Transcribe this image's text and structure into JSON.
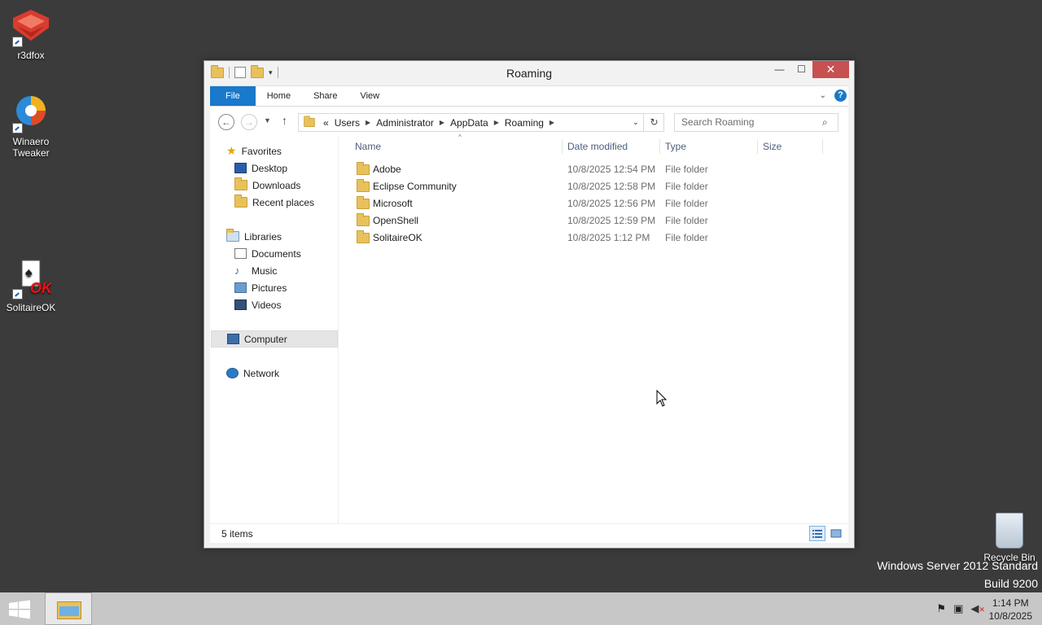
{
  "desktop": {
    "icons": [
      {
        "label": "r3dfox"
      },
      {
        "label": "Winaero\nTweaker"
      },
      {
        "label": "SolitaireOK"
      }
    ],
    "recycle_bin": "Recycle Bin",
    "watermark_line1": "Windows Server 2012 Standard",
    "watermark_line2": "Build 9200"
  },
  "window": {
    "title": "Roaming",
    "controls": {
      "minimize": "—",
      "maximize": "☐",
      "close": "✕"
    },
    "ribbon": {
      "tabs": [
        "File",
        "Home",
        "Share",
        "View"
      ],
      "help": "?"
    },
    "address": {
      "overflow": "«",
      "crumbs": [
        "Users",
        "Administrator",
        "AppData",
        "Roaming"
      ]
    },
    "search": {
      "placeholder": "Search Roaming"
    },
    "nav": {
      "favorites": "Favorites",
      "desktop": "Desktop",
      "downloads": "Downloads",
      "recent": "Recent places",
      "libraries": "Libraries",
      "documents": "Documents",
      "music": "Music",
      "pictures": "Pictures",
      "videos": "Videos",
      "computer": "Computer",
      "network": "Network"
    },
    "columns": {
      "name": "Name",
      "date": "Date modified",
      "type": "Type",
      "size": "Size"
    },
    "files": [
      {
        "name": "Adobe",
        "date": "10/8/2025 12:54 PM",
        "type": "File folder"
      },
      {
        "name": "Eclipse Community",
        "date": "10/8/2025 12:58 PM",
        "type": "File folder"
      },
      {
        "name": "Microsoft",
        "date": "10/8/2025 12:56 PM",
        "type": "File folder"
      },
      {
        "name": "OpenShell",
        "date": "10/8/2025 12:59 PM",
        "type": "File folder"
      },
      {
        "name": "SolitaireOK",
        "date": "10/8/2025 1:12 PM",
        "type": "File folder"
      }
    ],
    "status": {
      "count": "5 items"
    }
  },
  "taskbar": {
    "time": "1:14 PM",
    "date": "10/8/2025"
  },
  "colors": {
    "file_tab": "#1979ca",
    "close": "#c75050",
    "desktop": "#3b3b3b",
    "taskbar": "#c7c7c7"
  }
}
